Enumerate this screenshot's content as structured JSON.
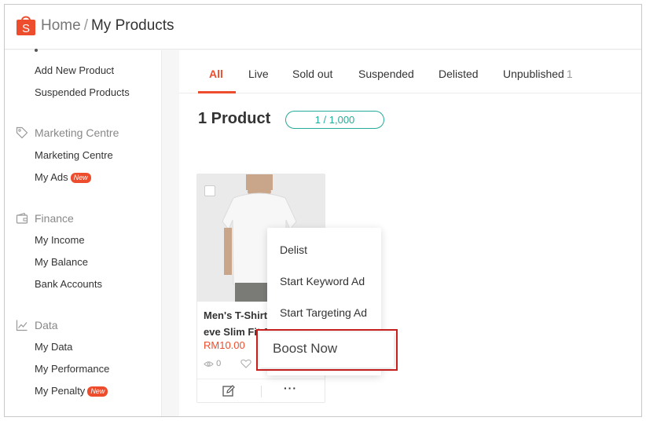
{
  "header": {
    "logo_letter": "S",
    "breadcrumb_home": "Home",
    "breadcrumb_separator": "/",
    "breadcrumb_current": "My Products",
    "brand_color": "#ee4d2d"
  },
  "sidebar": {
    "product_links": [
      {
        "label": "Add New Product"
      },
      {
        "label": "Suspended Products"
      }
    ],
    "marketing": {
      "title": "Marketing Centre",
      "icon": "tag-icon",
      "links": [
        {
          "label": "Marketing Centre"
        },
        {
          "label": "My Ads",
          "badge": "New"
        }
      ]
    },
    "finance": {
      "title": "Finance",
      "icon": "wallet-icon",
      "links": [
        {
          "label": "My Income"
        },
        {
          "label": "My Balance"
        },
        {
          "label": "Bank Accounts"
        }
      ]
    },
    "data": {
      "title": "Data",
      "icon": "chart-line-icon",
      "links": [
        {
          "label": "My Data"
        },
        {
          "label": "My Performance"
        },
        {
          "label": "My Penalty",
          "badge": "New"
        }
      ]
    }
  },
  "tabs": [
    {
      "label": "All",
      "active": true
    },
    {
      "label": "Live"
    },
    {
      "label": "Sold out"
    },
    {
      "label": "Suspended"
    },
    {
      "label": "Delisted"
    },
    {
      "label": "Unpublished",
      "count": "1"
    }
  ],
  "summary": {
    "product_count": "1 Product",
    "quota": "1 / 1,000",
    "quota_color": "#26aa99"
  },
  "product": {
    "name_line1": "Men's T-Shirt",
    "name_line2": "eve Slim Fit 1",
    "price": "RM10.00",
    "views": "0"
  },
  "menu": {
    "items": [
      {
        "label": "Delist"
      },
      {
        "label": "Start Keyword Ad"
      },
      {
        "label": "Start Targeting Ad"
      }
    ],
    "highlighted_item": "Boost Now",
    "highlight_color": "#cc1f1f"
  }
}
